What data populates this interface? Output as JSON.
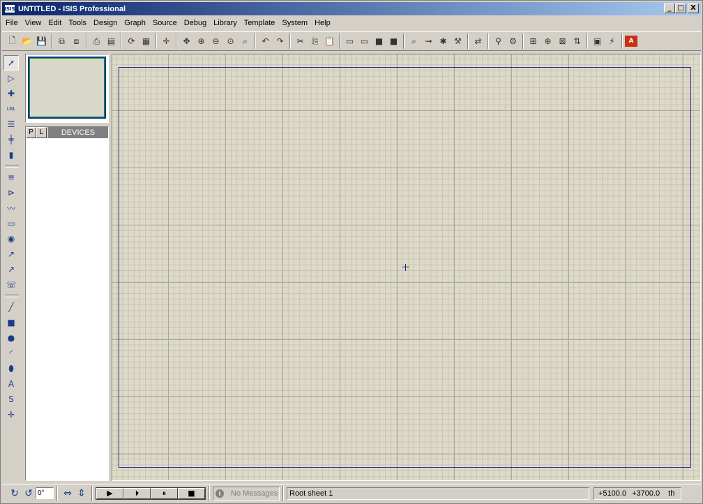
{
  "window": {
    "title": "UNTITLED - ISIS Professional",
    "app_icon_text": "ISIS"
  },
  "window_buttons": {
    "minimize": "_",
    "maximize": "□",
    "close": "X"
  },
  "menu": [
    "File",
    "View",
    "Edit",
    "Tools",
    "Design",
    "Graph",
    "Source",
    "Debug",
    "Library",
    "Template",
    "System",
    "Help"
  ],
  "toolbar": {
    "groups": [
      [
        {
          "name": "new-file-icon",
          "glyph": "🗋"
        },
        {
          "name": "open-folder-icon",
          "glyph": "📂"
        },
        {
          "name": "save-icon",
          "glyph": "💾"
        }
      ],
      [
        {
          "name": "import-section-icon",
          "glyph": "⧉"
        },
        {
          "name": "export-section-icon",
          "glyph": "⧈"
        }
      ],
      [
        {
          "name": "print-icon",
          "glyph": "⎙"
        },
        {
          "name": "area-icon",
          "glyph": "▤"
        }
      ],
      [
        {
          "name": "redraw-icon",
          "glyph": "⟳"
        },
        {
          "name": "grid-icon",
          "glyph": "▦"
        }
      ],
      [
        {
          "name": "origin-icon",
          "glyph": "✛"
        }
      ],
      [
        {
          "name": "pan-icon",
          "glyph": "✥"
        },
        {
          "name": "zoom-in-icon",
          "glyph": "⊕"
        },
        {
          "name": "zoom-out-icon",
          "glyph": "⊖"
        },
        {
          "name": "zoom-all-icon",
          "glyph": "⊙"
        },
        {
          "name": "zoom-area-icon",
          "glyph": "⌕"
        }
      ],
      [
        {
          "name": "undo-icon",
          "glyph": "↶"
        },
        {
          "name": "redo-icon",
          "glyph": "↷"
        }
      ],
      [
        {
          "name": "cut-icon",
          "glyph": "✂"
        },
        {
          "name": "copy-icon",
          "glyph": "⎘"
        },
        {
          "name": "paste-icon",
          "glyph": "📋"
        }
      ],
      [
        {
          "name": "block-copy-icon",
          "glyph": "▭"
        },
        {
          "name": "block-move-icon",
          "glyph": "▭"
        },
        {
          "name": "block-rotate-icon",
          "glyph": "■"
        },
        {
          "name": "block-delete-icon",
          "glyph": "■"
        }
      ],
      [
        {
          "name": "pick-device-icon",
          "glyph": "⌕"
        },
        {
          "name": "make-device-icon",
          "glyph": "⇝"
        },
        {
          "name": "package-tool-icon",
          "glyph": "✱"
        },
        {
          "name": "decompose-icon",
          "glyph": "⚒"
        }
      ],
      [
        {
          "name": "wire-autorouter-icon",
          "glyph": "⇄"
        }
      ],
      [
        {
          "name": "search-tag-icon",
          "glyph": "⚲"
        },
        {
          "name": "property-assign-icon",
          "glyph": "⚙"
        }
      ],
      [
        {
          "name": "new-sheet-icon",
          "glyph": "⊞"
        },
        {
          "name": "add-sheet-icon",
          "glyph": "⊕"
        },
        {
          "name": "remove-sheet-icon",
          "glyph": "⊠"
        },
        {
          "name": "goto-sheet-icon",
          "glyph": "⇅"
        }
      ],
      [
        {
          "name": "bill-of-materials-icon",
          "glyph": "▣"
        },
        {
          "name": "electrical-check-icon",
          "glyph": "⚡"
        }
      ],
      [
        {
          "name": "netlist-to-ares-icon",
          "glyph": "A"
        }
      ]
    ]
  },
  "left_tools": [
    {
      "name": "selection-mode-icon",
      "glyph": "➚",
      "selected": true
    },
    {
      "name": "component-mode-icon",
      "glyph": "▷"
    },
    {
      "name": "junction-dot-icon",
      "glyph": "✚"
    },
    {
      "name": "wire-label-icon",
      "glyph": "LBL"
    },
    {
      "name": "text-script-icon",
      "glyph": "☰"
    },
    {
      "name": "buses-icon",
      "glyph": "╪"
    },
    {
      "name": "subcircuit-icon",
      "glyph": "▮"
    },
    {
      "sep": true
    },
    {
      "name": "terminals-icon",
      "glyph": "≡"
    },
    {
      "name": "device-pins-icon",
      "glyph": "⊳"
    },
    {
      "name": "graph-mode-icon",
      "glyph": "〰"
    },
    {
      "name": "tape-recorder-icon",
      "glyph": "▭"
    },
    {
      "name": "generator-icon",
      "glyph": "◉"
    },
    {
      "name": "voltage-probe-icon",
      "glyph": "↗"
    },
    {
      "name": "current-probe-icon",
      "glyph": "↗"
    },
    {
      "name": "virtual-instruments-icon",
      "glyph": "☏"
    },
    {
      "sep": true
    },
    {
      "name": "line-tool-icon",
      "glyph": "╱"
    },
    {
      "name": "box-tool-icon",
      "glyph": "■"
    },
    {
      "name": "circle-tool-icon",
      "glyph": "●"
    },
    {
      "name": "arc-tool-icon",
      "glyph": "◜"
    },
    {
      "name": "path-tool-icon",
      "glyph": "⬮"
    },
    {
      "name": "text-tool-icon",
      "glyph": "A"
    },
    {
      "name": "symbol-tool-icon",
      "glyph": "S"
    },
    {
      "name": "marker-tool-icon",
      "glyph": "✛"
    }
  ],
  "devices": {
    "pick_label": "P",
    "library_label": "L",
    "title": "DEVICES"
  },
  "status": {
    "rotation": "0°",
    "messages": "No Messages",
    "sheet": "Root sheet 1",
    "x": "+5100.0",
    "y": "+3700.0",
    "units": "th"
  },
  "sim_controls": [
    {
      "name": "play-button",
      "glyph": "▶"
    },
    {
      "name": "step-button",
      "glyph": "⏵"
    },
    {
      "name": "pause-button",
      "glyph": "⏸"
    },
    {
      "name": "stop-button",
      "glyph": "■"
    }
  ]
}
